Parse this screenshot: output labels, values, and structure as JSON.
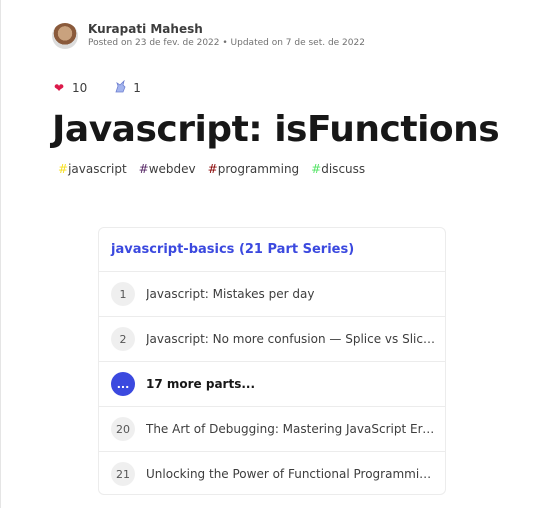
{
  "author": {
    "name": "Kurapati Mahesh",
    "meta": "Posted on 23 de fev. de 2022 • Updated on 7 de set. de 2022"
  },
  "reactions": [
    {
      "icon": "heart-icon",
      "count": "10"
    },
    {
      "icon": "unicorn-icon",
      "count": "1"
    }
  ],
  "article": {
    "title": "Javascript: isFunctions"
  },
  "tags": [
    {
      "name": "javascript",
      "color": "#f7df1e"
    },
    {
      "name": "webdev",
      "color": "#562765"
    },
    {
      "name": "programming",
      "color": "#890606"
    },
    {
      "name": "discuss",
      "color": "#54e466"
    }
  ],
  "series": {
    "title": "javascript-basics (21 Part Series)",
    "items": [
      {
        "number": "1",
        "label": "Javascript: Mistakes per day"
      },
      {
        "number": "2",
        "label": "Javascript: No more confusion — Splice vs Slice vs Split"
      },
      {
        "number": "...",
        "label": "17 more parts..."
      },
      {
        "number": "20",
        "label": "The Art of Debugging: Mastering JavaScript Errors"
      },
      {
        "number": "21",
        "label": "Unlocking the Power of Functional Programming in JavaScript"
      }
    ]
  },
  "colors": {
    "accent": "#3b49df",
    "heart": "#dc1a4a"
  }
}
